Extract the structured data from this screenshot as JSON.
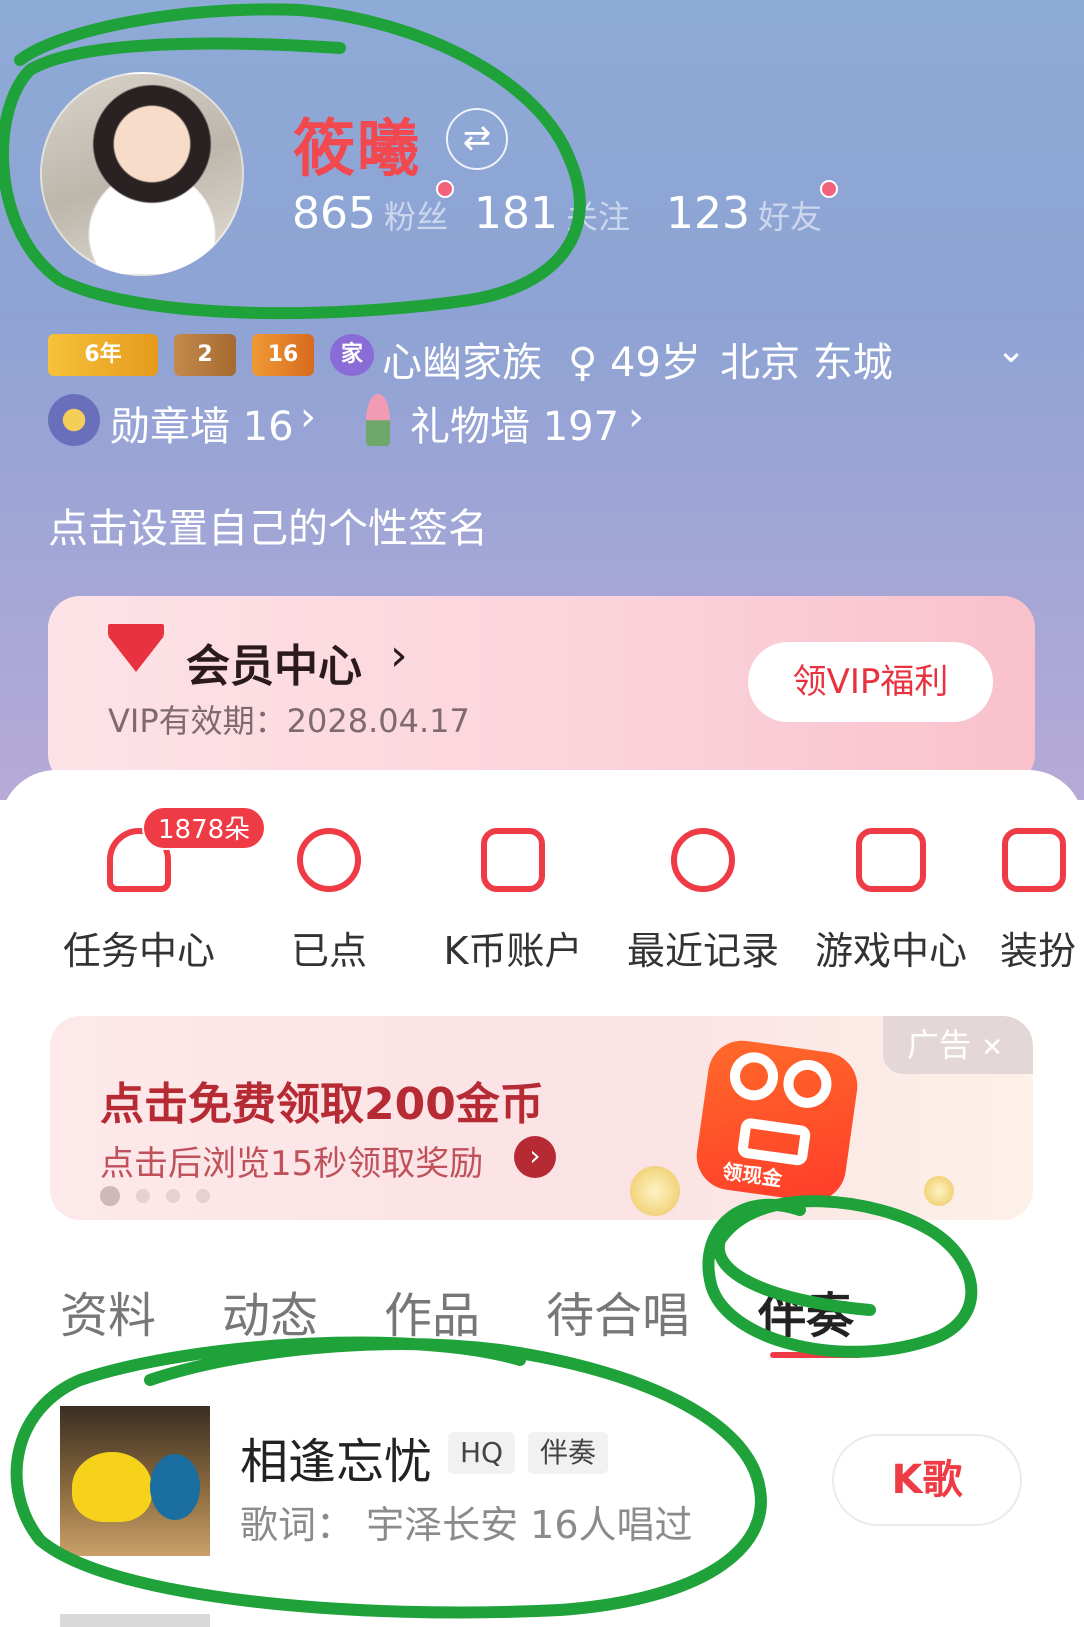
{
  "profile": {
    "name": "筱曦",
    "switch_icon": "⇄",
    "stats": {
      "fans_count": "865",
      "fans_label": "粉丝",
      "follow_count": "181",
      "follow_label": "关注",
      "friends_count": "123",
      "friends_label": "好友"
    },
    "badges": {
      "years_label": "6年",
      "level_a": "2",
      "level_b": "16",
      "family_badge": "家",
      "family_name": "心幽家族",
      "gender_age": "♀ 49岁",
      "location": "北京 东城"
    },
    "walls": {
      "medal_label": "勋章墙 16",
      "gift_label": "礼物墙 197"
    },
    "signature_placeholder": "点击设置自己的个性签名"
  },
  "vip": {
    "title": "会员中心",
    "expire": "VIP有效期：2028.04.17",
    "button": "领VIP福利"
  },
  "shortcuts": [
    {
      "label": "任务中心",
      "badge": "1878朵"
    },
    {
      "label": "已点"
    },
    {
      "label": "K币账户"
    },
    {
      "label": "最近记录"
    },
    {
      "label": "游戏中心"
    },
    {
      "label": "装扮"
    }
  ],
  "ad": {
    "tag": "广告",
    "title": "点击免费领取200金币",
    "subtitle": "点击后浏览15秒领取奖励",
    "app_label": "领现金"
  },
  "tabs": [
    "资料",
    "动态",
    "作品",
    "待合唱",
    "伴奏"
  ],
  "active_tab": "伴奏",
  "song": {
    "title": "相逢忘忧",
    "chips": [
      "HQ",
      "伴奏"
    ],
    "meta": "歌词：  宇泽长安  16人唱过",
    "action": "K歌"
  },
  "colors": {
    "accent": "#ee3b45",
    "name_red": "#f2484f",
    "annotation_green": "#1fa23a"
  }
}
